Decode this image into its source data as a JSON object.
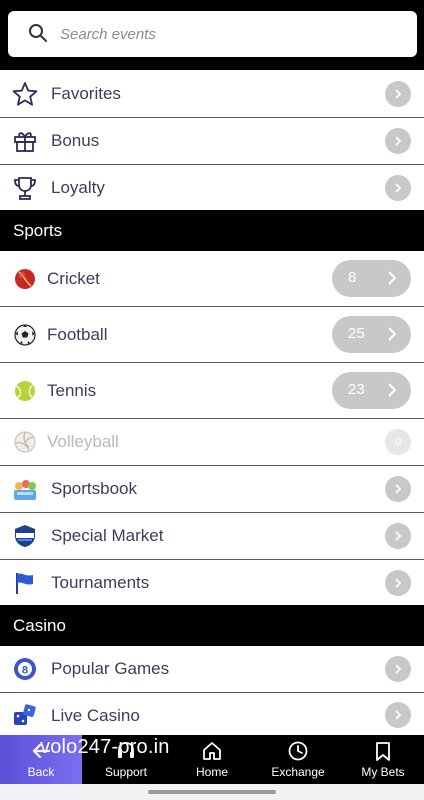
{
  "search": {
    "placeholder": "Search events"
  },
  "menu": [
    {
      "label": "Favorites",
      "icon": "star-icon"
    },
    {
      "label": "Bonus",
      "icon": "gift-icon"
    },
    {
      "label": "Loyalty",
      "icon": "trophy-icon"
    }
  ],
  "sections": {
    "sports": "Sports",
    "casino": "Casino"
  },
  "sports": [
    {
      "label": "Cricket",
      "count": "8",
      "icon": "cricket-ball-icon"
    },
    {
      "label": "Football",
      "count": "25",
      "icon": "football-icon"
    },
    {
      "label": "Tennis",
      "count": "23",
      "icon": "tennis-ball-icon"
    },
    {
      "label": "Volleyball",
      "count": "0",
      "icon": "volleyball-icon"
    }
  ],
  "extras": [
    {
      "label": "Sportsbook",
      "icon": "sportsbook-icon"
    },
    {
      "label": "Special Market",
      "icon": "special-market-icon"
    },
    {
      "label": "Tournaments",
      "icon": "flag-icon"
    }
  ],
  "casino": [
    {
      "label": "Popular Games",
      "icon": "popular-games-icon"
    },
    {
      "label": "Live Casino",
      "icon": "dice-icon"
    }
  ],
  "bottom_nav": {
    "back": "Back",
    "support": "Support",
    "home": "Home",
    "exchange": "Exchange",
    "my_bets": "My Bets"
  },
  "watermark": "volo247-pro.in",
  "colors": {
    "accent": "#6b5fe6",
    "header": "#000000",
    "chevron_bg": "#c8c8c8"
  }
}
